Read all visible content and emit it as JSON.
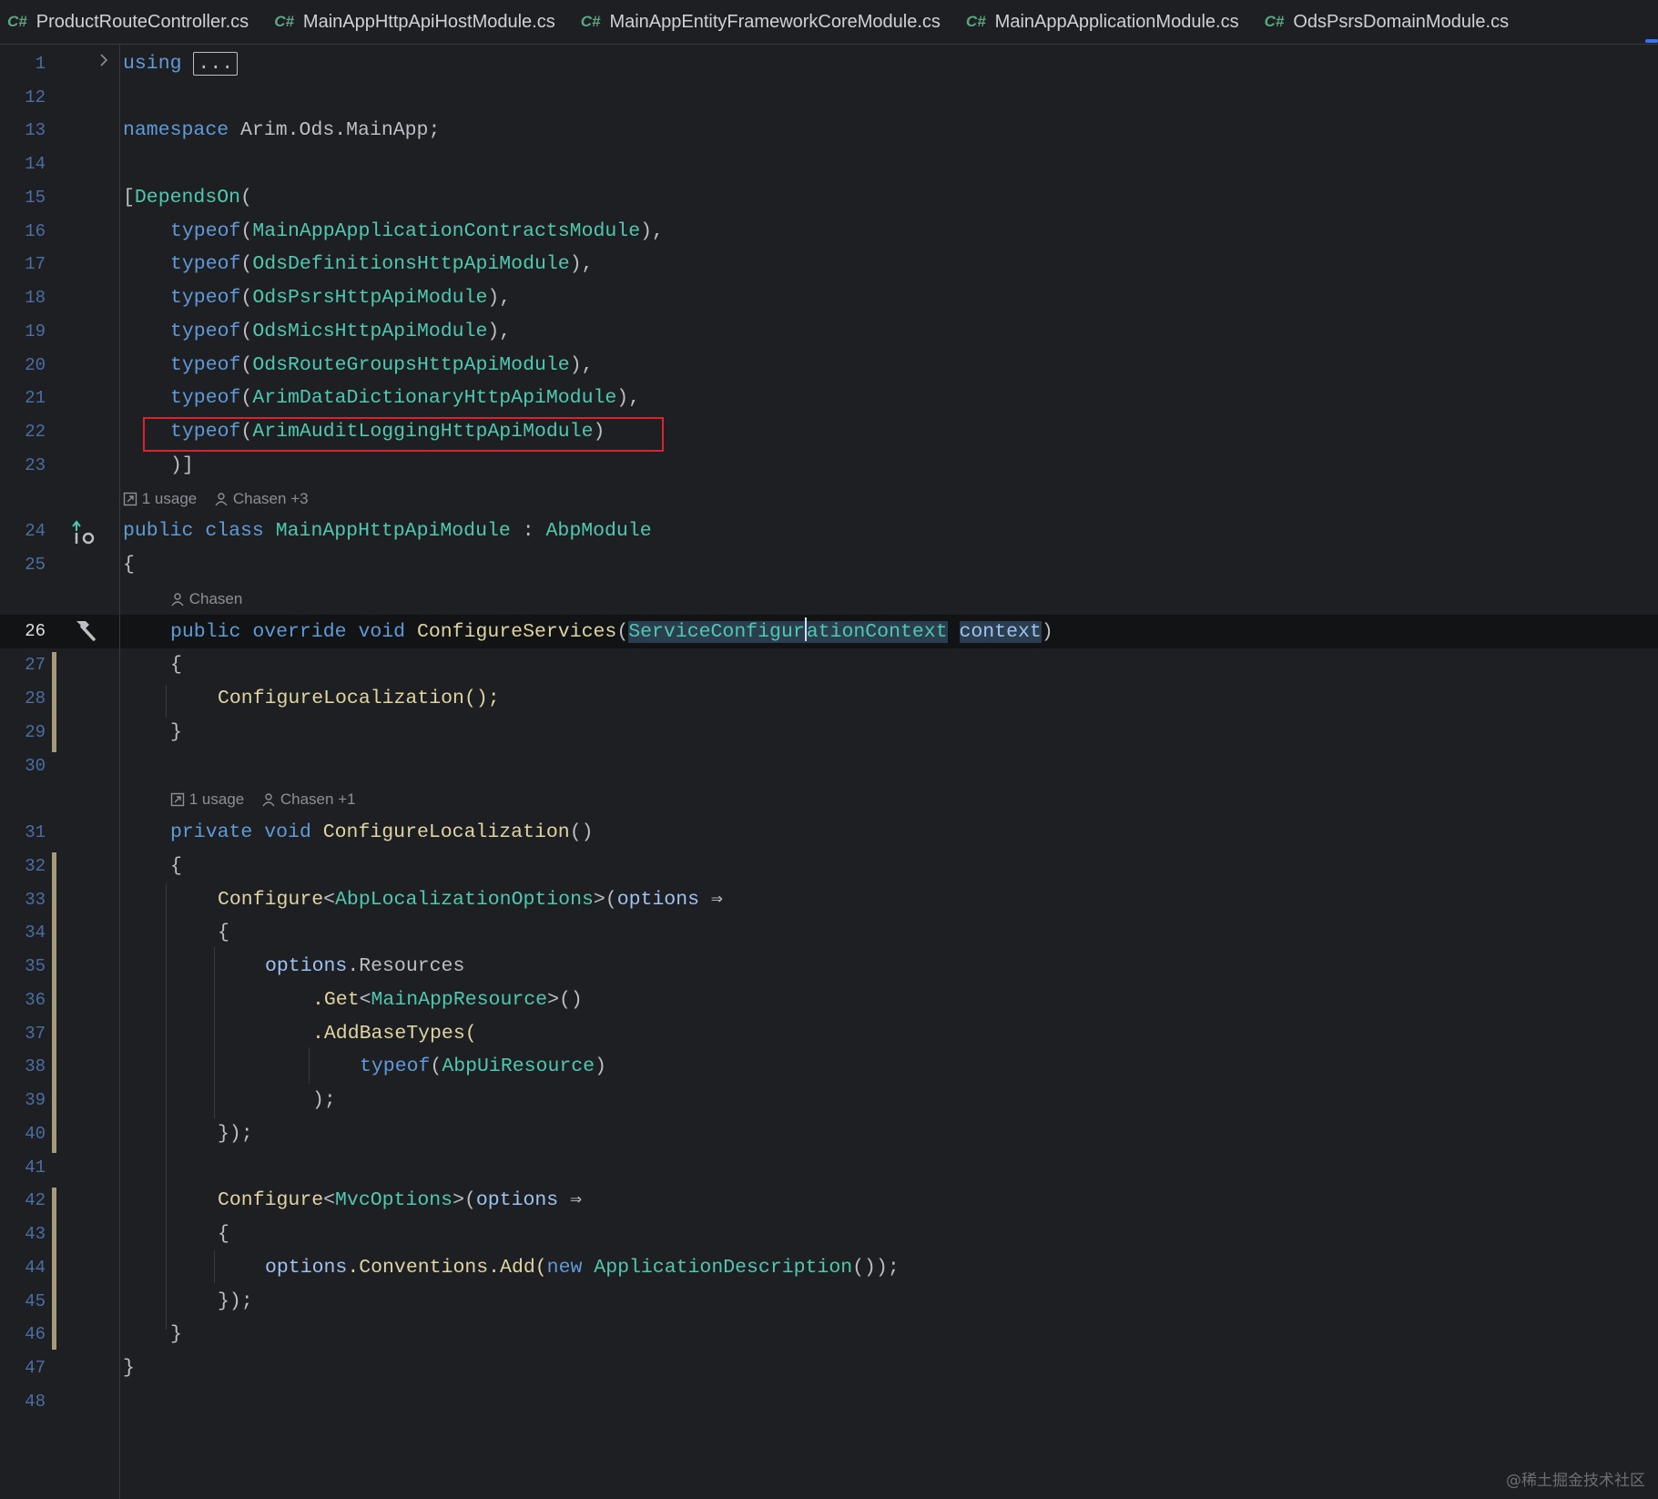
{
  "tabs": [
    {
      "icon": "C#",
      "label": "ProductRouteController.cs"
    },
    {
      "icon": "C#",
      "label": "MainAppHttpApiHostModule.cs"
    },
    {
      "icon": "C#",
      "label": "MainAppEntityFrameworkCoreModule.cs"
    },
    {
      "icon": "C#",
      "label": "MainAppApplicationModule.cs"
    },
    {
      "icon": "C#",
      "label": "OdsPsrsDomainModule.cs"
    }
  ],
  "line_numbers": {
    "l1": "1",
    "l12": "12",
    "l13": "13",
    "l14": "14",
    "l15": "15",
    "l16": "16",
    "l17": "17",
    "l18": "18",
    "l19": "19",
    "l20": "20",
    "l21": "21",
    "l22": "22",
    "l23": "23",
    "l24": "24",
    "l25": "25",
    "l26": "26",
    "l27": "27",
    "l28": "28",
    "l29": "29",
    "l30": "30",
    "l31": "31",
    "l32": "32",
    "l33": "33",
    "l34": "34",
    "l35": "35",
    "l36": "36",
    "l37": "37",
    "l38": "38",
    "l39": "39",
    "l40": "40",
    "l41": "41",
    "l42": "42",
    "l43": "43",
    "l44": "44",
    "l45": "45",
    "l46": "46",
    "l47": "47",
    "l48": "48"
  },
  "code": {
    "using_kw": "using",
    "using_fold": "...",
    "ns_kw": "namespace",
    "ns_name": " Arim.Ods.MainApp;",
    "attr_open": "[",
    "attr_name": "DependsOn",
    "paren_open": "(",
    "typeof": "typeof",
    "dep1": "MainAppApplicationContractsModule",
    "dep2": "OdsDefinitionsHttpApiModule",
    "dep3": "OdsPsrsHttpApiModule",
    "dep4": "OdsMicsHttpApiModule",
    "dep5": "OdsRouteGroupsHttpApiModule",
    "dep6": "ArimDataDictionaryHttpApiModule",
    "dep7": "ArimAuditLoggingHttpApiModule",
    "dep_sep": "),",
    "dep_last_close": ")",
    "attr_close": ")]",
    "public_kw": "public",
    "class_kw": "class",
    "class_name": "MainAppHttpApiModule",
    "colon": " : ",
    "base_class": "AbpModule",
    "brace_open": "{",
    "brace_close": "}",
    "override_kw": "override",
    "void_kw": "void",
    "configure_services": "ConfigureServices",
    "param_type_a": "ServiceConfigur",
    "param_type_b": "ationContext",
    "param_name": "context",
    "call_configure_localization": "ConfigureLocalization();",
    "private_kw": "private",
    "configure_localization": "ConfigureLocalization",
    "empty_parens": "()",
    "configure": "Configure",
    "lt": "<",
    "gt_open": ">(",
    "abp_loc_options": "AbpLocalizationOptions",
    "options": "options",
    "arrow": " ⇒",
    "resources": ".Resources",
    "get": ".Get",
    "main_app_resource": "MainAppResource",
    "gt_call": ">()",
    "add_base_types": ".AddBaseTypes(",
    "abp_ui_resource": "AbpUiResource",
    "close_call": ");",
    "close_lambda": "});",
    "mvc_options": "MvcOptions",
    "conventions_add": ".Conventions.Add(",
    "new_kw": "new",
    "app_description": "ApplicationDescription",
    "end_add": "());",
    "space": " "
  },
  "hints": {
    "class_usage": "1 usage",
    "class_authors": "Chasen +3",
    "method1_author": "Chasen",
    "method2_usage": "1 usage",
    "method2_authors": "Chasen +1"
  },
  "watermark": "@稀土掘金技术社区",
  "colors": {
    "background": "#1e1f22",
    "keyword": "#5e9bd8",
    "type": "#4ec9b0",
    "method": "#e0d4a3",
    "highlight_box": "#d9232f"
  }
}
